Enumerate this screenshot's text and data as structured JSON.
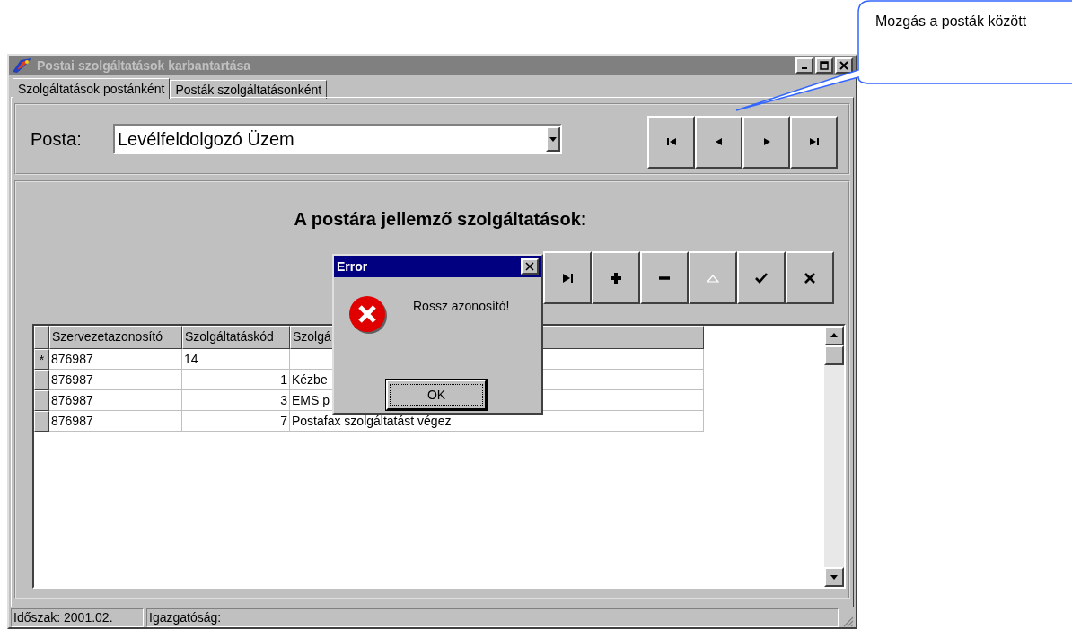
{
  "window": {
    "title": "Postai szolgáltatások karbantartása"
  },
  "tabs": [
    {
      "label": "Szolgáltatások postánként",
      "selected": true
    },
    {
      "label": "Posták szolgáltatásonként",
      "selected": false
    }
  ],
  "posta": {
    "label": "Posta:",
    "value": "Levélfeldolgozó Üzem"
  },
  "post_navigator": [
    {
      "kind": "first"
    },
    {
      "kind": "prior"
    },
    {
      "kind": "next"
    },
    {
      "kind": "last"
    }
  ],
  "services_heading": "A postára jellemző szolgáltatások:",
  "record_navigator": [
    {
      "kind": "last",
      "disabled": false
    },
    {
      "kind": "insert",
      "disabled": false
    },
    {
      "kind": "delete",
      "disabled": false
    },
    {
      "kind": "edit",
      "disabled": true
    },
    {
      "kind": "post",
      "disabled": false
    },
    {
      "kind": "cancel",
      "disabled": false
    }
  ],
  "grid": {
    "columns": [
      "Szervezetazonosító",
      "Szolgáltatáskód",
      "Szolgá"
    ],
    "rows": [
      {
        "kind": "new",
        "marker": "*",
        "cells": [
          "876987",
          "14"
        ]
      },
      {
        "kind": "record",
        "cells": [
          "876987",
          "1",
          "Kézbe"
        ]
      },
      {
        "kind": "record",
        "cells": [
          "876987",
          "3",
          "EMS p"
        ]
      },
      {
        "kind": "record",
        "cells": [
          "876987",
          "7",
          "Postafax szolgáltatást végez"
        ]
      }
    ]
  },
  "dialog": {
    "title": "Error",
    "message": "Rossz azonosító!",
    "button": "OK"
  },
  "status_bar": [
    "Időszak: 2001.02.",
    "Igazgatóság:"
  ],
  "callout": "Mozgás a posták között"
}
